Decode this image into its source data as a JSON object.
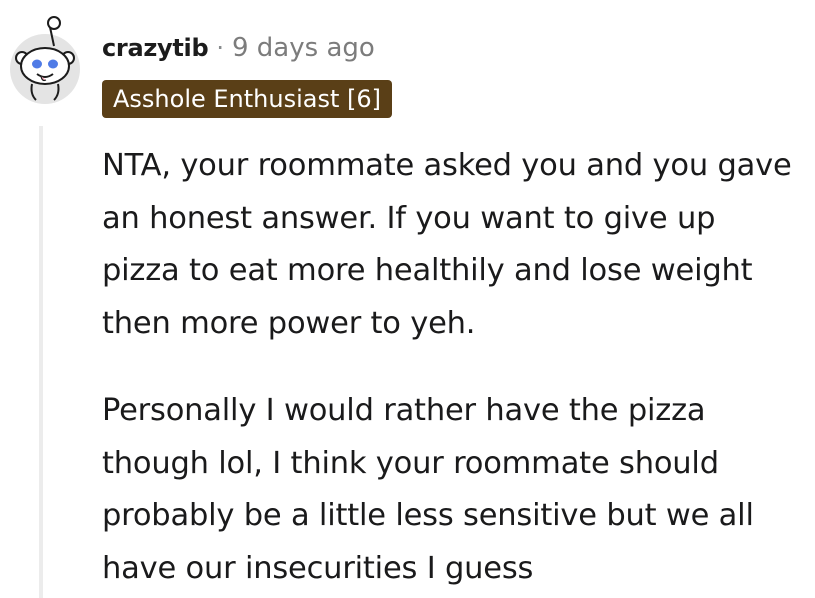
{
  "comment": {
    "username": "crazytib",
    "separator": "·",
    "timestamp": "9 days ago",
    "flair": "Asshole Enthusiast [6]",
    "paragraphs": [
      "NTA, your roommate asked you and you gave an honest answer. If you want to give up pizza to eat more healthily and lose weight then more power to yeh.",
      "Personally I would rather have the pizza though lol, I think your roommate should probably be a little less sensitive but we all have our insecurities I guess"
    ]
  },
  "colors": {
    "flair_background": "#5a3f17",
    "username": "#1c1c1c",
    "timestamp": "#7c7c7c",
    "thread_line": "#ececec",
    "avatar_background": "#e4e4e4"
  },
  "icons": {
    "avatar": "snoo-avatar-icon"
  }
}
